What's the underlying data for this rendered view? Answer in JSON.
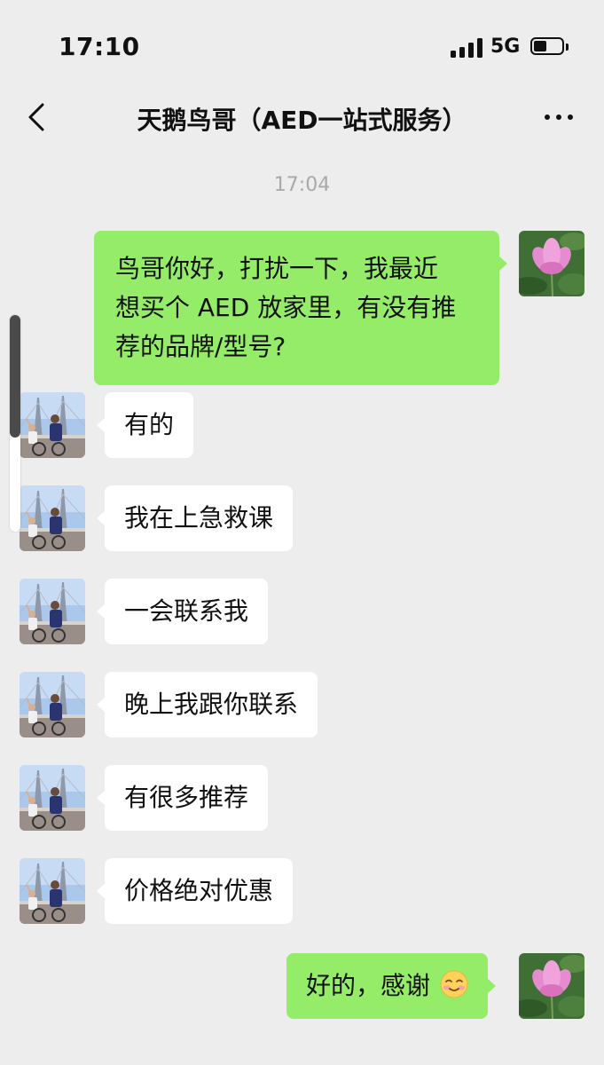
{
  "status_bar": {
    "time": "17:10",
    "network": "5G"
  },
  "header": {
    "title": "天鹅鸟哥（AED一站式服务）"
  },
  "chat": {
    "timestamp": "17:04",
    "messages": [
      {
        "from": "me",
        "text_lines": [
          "鸟哥你好，打扰一下，我最近",
          "想买个 AED 放家里，有没有推",
          "荐的品牌/型号?"
        ]
      },
      {
        "from": "contact",
        "text": "有的"
      },
      {
        "from": "contact",
        "text": "我在上急救课"
      },
      {
        "from": "contact",
        "text": "一会联系我"
      },
      {
        "from": "contact",
        "text": "晚上我跟你联系"
      },
      {
        "from": "contact",
        "text": "有很多推荐"
      },
      {
        "from": "contact",
        "text": "价格绝对优惠"
      },
      {
        "from": "me",
        "text": "好的，感谢",
        "emoji": "smiling-face-emoji"
      }
    ]
  },
  "colors": {
    "background": "#ededed",
    "outgoing_bubble": "#95ec69",
    "incoming_bubble": "#ffffff",
    "timestamp": "#a9a9a9"
  }
}
